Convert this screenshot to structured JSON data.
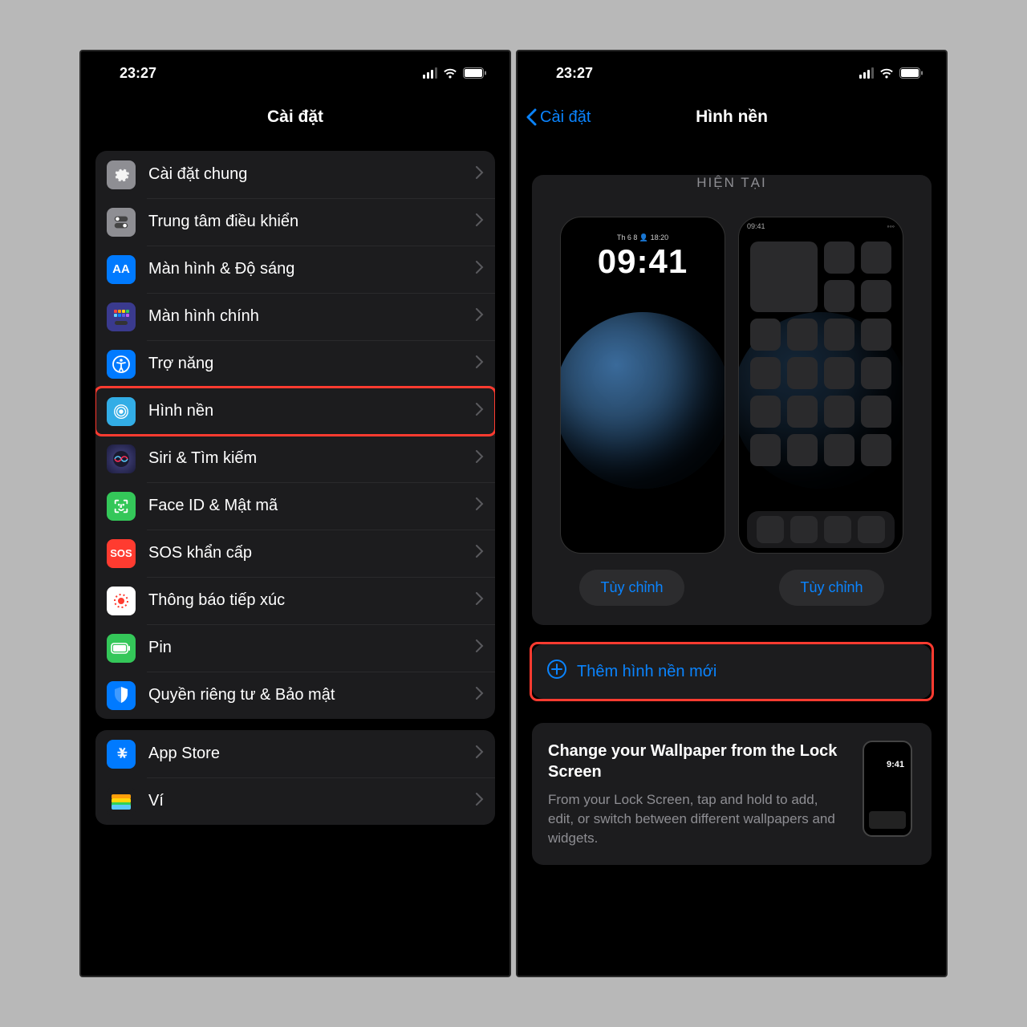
{
  "status": {
    "time": "23:27"
  },
  "left": {
    "title": "Cài đặt",
    "group1": [
      {
        "label": "Cài đặt chung",
        "icon": "gear"
      },
      {
        "label": "Trung tâm điều khiển",
        "icon": "control-center"
      },
      {
        "label": "Màn hình & Độ sáng",
        "icon": "display"
      },
      {
        "label": "Màn hình chính",
        "icon": "home-grid"
      },
      {
        "label": "Trợ năng",
        "icon": "accessibility"
      },
      {
        "label": "Hình nền",
        "icon": "wallpaper",
        "highlighted": true
      },
      {
        "label": "Siri & Tìm kiếm",
        "icon": "siri"
      },
      {
        "label": "Face ID & Mật mã",
        "icon": "faceid"
      },
      {
        "label": "SOS khẩn cấp",
        "icon": "sos"
      },
      {
        "label": "Thông báo tiếp xúc",
        "icon": "exposure"
      },
      {
        "label": "Pin",
        "icon": "battery"
      },
      {
        "label": "Quyền riêng tư & Bảo mật",
        "icon": "privacy"
      }
    ],
    "group2": [
      {
        "label": "App Store",
        "icon": "appstore"
      },
      {
        "label": "Ví",
        "icon": "wallet"
      }
    ]
  },
  "right": {
    "back": "Cài đặt",
    "title": "Hình nền",
    "current_label": "HIỆN TẠI",
    "lock_preview": {
      "date": "Th 6 8 👤 18:20",
      "time": "09:41"
    },
    "home_preview": {
      "status_time": "09:41"
    },
    "customize": "Tùy chỉnh",
    "add_new": "Thêm hình nền mới",
    "tip": {
      "title": "Change your Wallpaper from the Lock Screen",
      "body": "From your Lock Screen, tap and hold to add, edit, or switch between different wallpapers and widgets.",
      "mini_time": "9:41"
    }
  }
}
